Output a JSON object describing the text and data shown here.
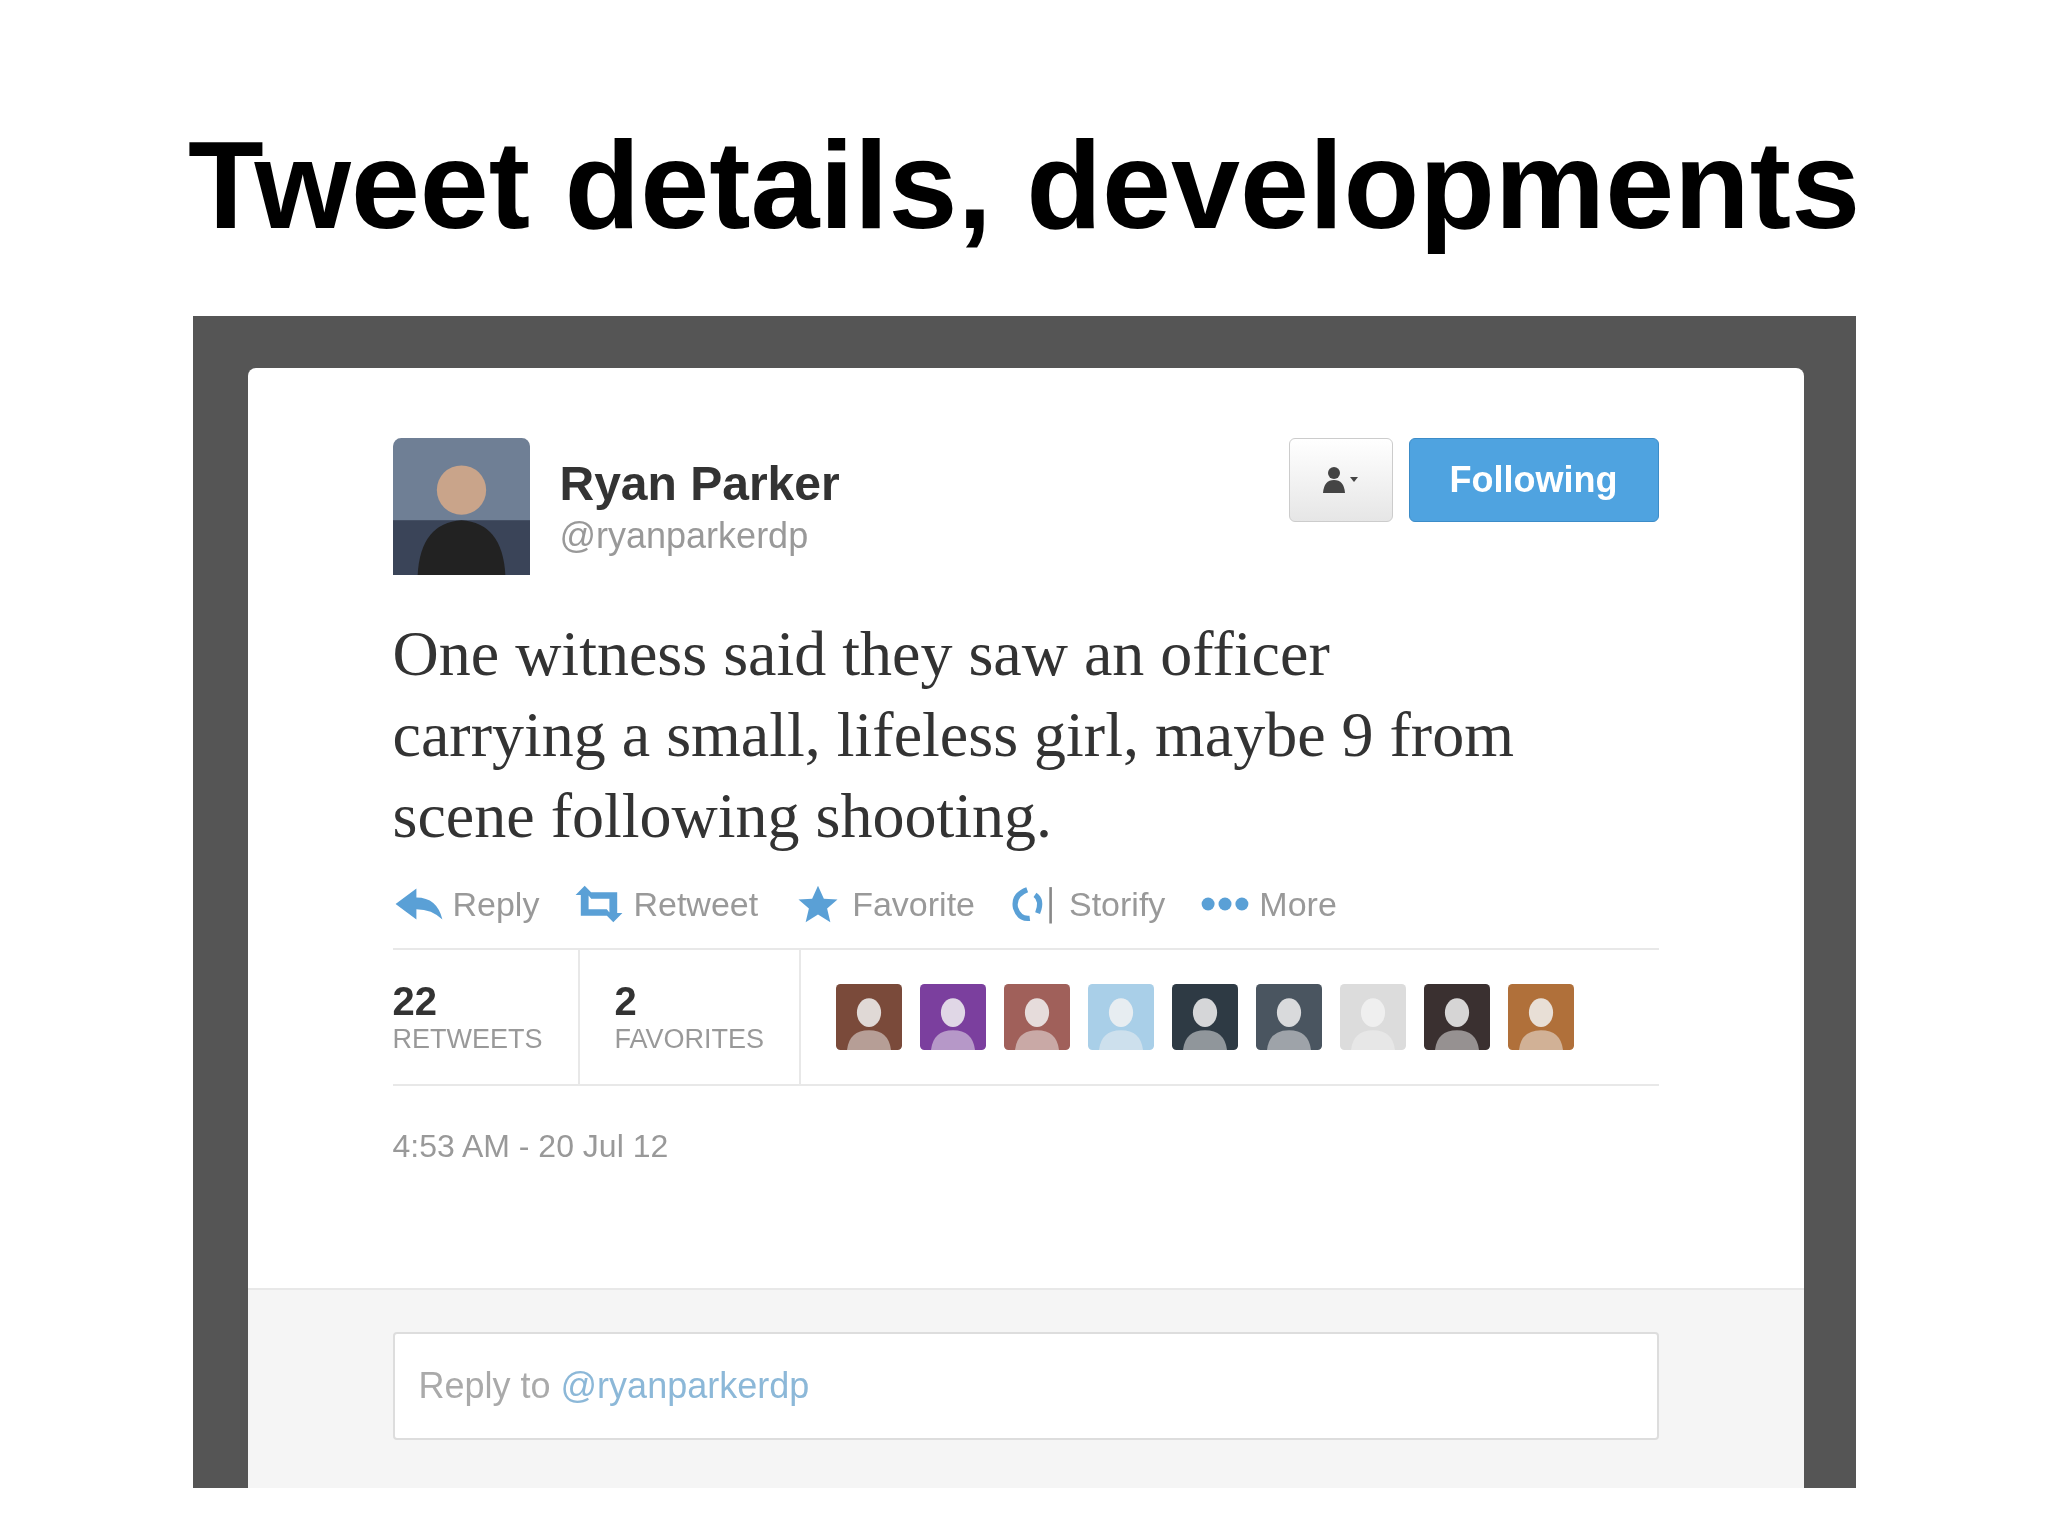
{
  "slide_title": "Tweet details, developments",
  "tweet": {
    "author": {
      "name": "Ryan Parker",
      "handle": "@ryanparkerdp"
    },
    "follow_button": {
      "label": "Following",
      "on": true
    },
    "text": "One witness said they saw an officer carrying a small, lifeless girl, maybe 9 from scene following shooting.",
    "actions": [
      {
        "kind": "reply",
        "label": "Reply"
      },
      {
        "kind": "retweet",
        "label": "Retweet"
      },
      {
        "kind": "favorite",
        "label": "Favorite"
      },
      {
        "kind": "storify",
        "label": "Storify"
      },
      {
        "kind": "more",
        "label": "More"
      }
    ],
    "stats": [
      {
        "count": "22",
        "label": "RETWEETS"
      },
      {
        "count": "2",
        "label": "FAVORITES"
      }
    ],
    "faces": [
      {
        "color": "#7a4a3a"
      },
      {
        "color": "#7b3f9e"
      },
      {
        "color": "#a0605a"
      },
      {
        "color": "#a9cfe8"
      },
      {
        "color": "#2e3a44"
      },
      {
        "color": "#4a5560"
      },
      {
        "color": "#dcdcdc"
      },
      {
        "color": "#3a3030"
      },
      {
        "color": "#b0703a"
      }
    ],
    "timestamp": "4:53 AM - 20 Jul 12",
    "reply_box": {
      "placeholder": "Reply to ",
      "mention": "@ryanparkerdp"
    }
  }
}
